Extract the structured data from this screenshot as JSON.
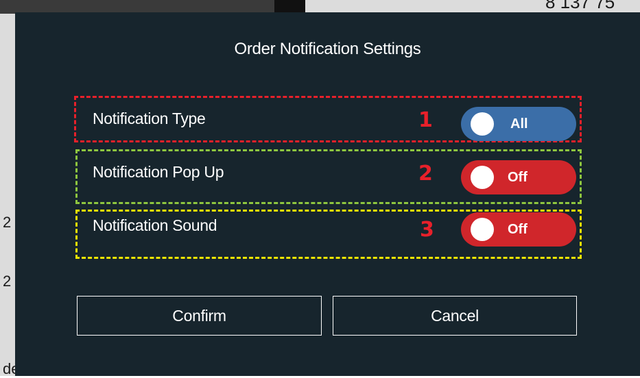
{
  "background": {
    "peek_top_right": "8 137 75",
    "peek_left_1": "2",
    "peek_left_2": "2",
    "peek_bottom_left": "de"
  },
  "modal": {
    "title": "Order Notification Settings",
    "rows": [
      {
        "label": "Notification Type",
        "number": "1",
        "toggle_text": "All",
        "toggle_color": "#3b6ea8",
        "highlight_color": "#e8202a",
        "number_color": "#e8202a"
      },
      {
        "label": "Notification Pop Up",
        "number": "2",
        "toggle_text": "Off",
        "toggle_color": "#d0262b",
        "highlight_color": "#8ec63f",
        "number_color": "#e8202a"
      },
      {
        "label": "Notification Sound",
        "number": "3",
        "toggle_text": "Off",
        "toggle_color": "#d0262b",
        "highlight_color": "#f2e600",
        "number_color": "#e8202a"
      }
    ],
    "confirm_label": "Confirm",
    "cancel_label": "Cancel"
  }
}
